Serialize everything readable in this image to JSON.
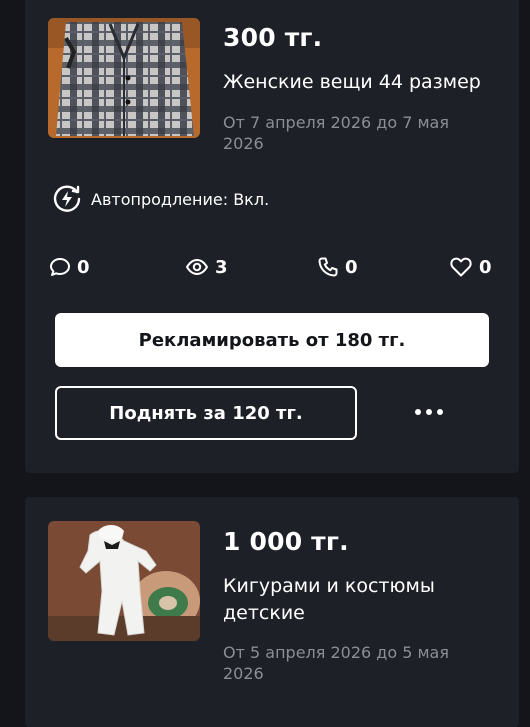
{
  "listings": [
    {
      "price": "300 тг.",
      "title": "Женские вещи 44 размер",
      "dates": "От 7 апреля 2026 до 7 мая 2026",
      "image_icon": "plaid-coat-photo",
      "autoprolong": "Автопродление: Вкл.",
      "stats": {
        "comments": "0",
        "views": "3",
        "calls": "0",
        "favorites": "0"
      },
      "advertise_label": "Рекламировать от 180 тг.",
      "raise_label": "Поднять за 120 тг.",
      "more_icon": "more-dots-icon"
    },
    {
      "price": "1 000 тг.",
      "title": "Кигурами и костюмы детские",
      "dates": "От 5 апреля 2026 до 5 мая 2026",
      "image_icon": "kigurumi-costume-photo"
    }
  ],
  "colors": {
    "background": "#13151a",
    "card": "#1d2027",
    "muted_text": "#8a8e96",
    "primary_button": "#ffffff",
    "primary_button_text": "#13151a"
  }
}
